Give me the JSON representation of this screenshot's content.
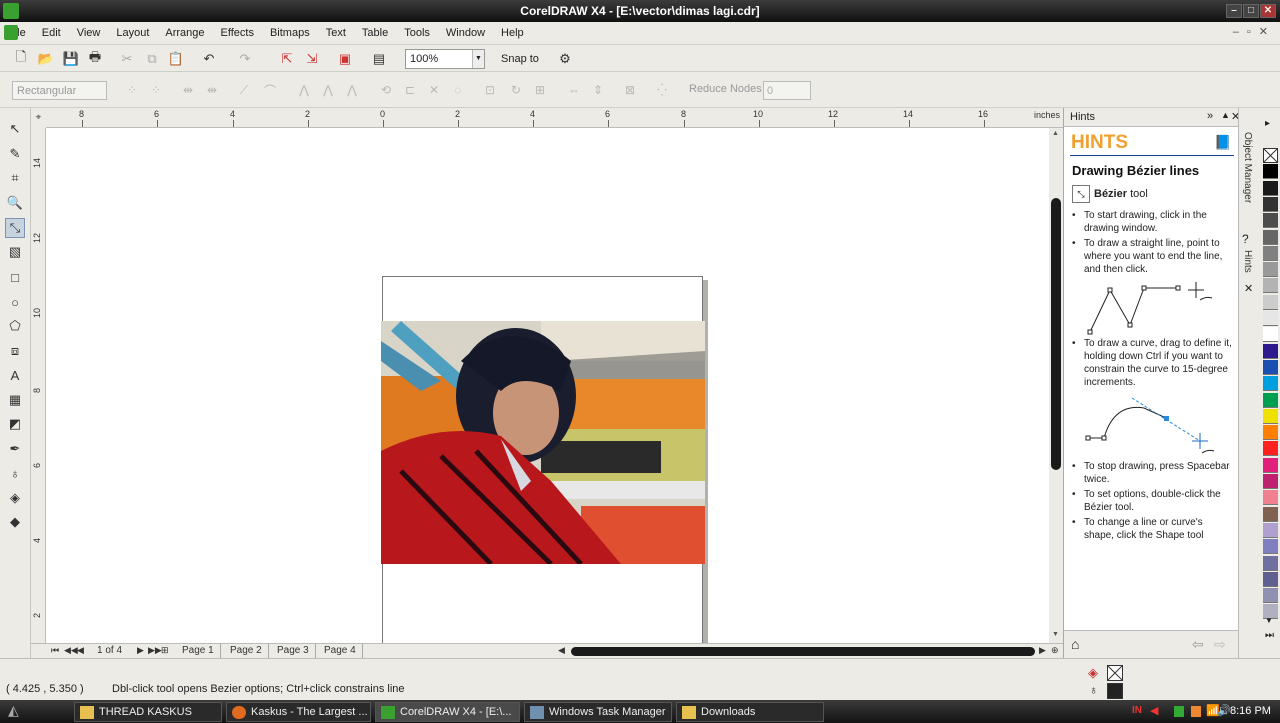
{
  "window": {
    "title": "CorelDRAW X4 - [E:\\vector\\dimas lagi.cdr]",
    "min": "–",
    "max": "□",
    "close": "✕"
  },
  "menu": [
    "File",
    "Edit",
    "View",
    "Layout",
    "Arrange",
    "Effects",
    "Bitmaps",
    "Text",
    "Table",
    "Tools",
    "Window",
    "Help"
  ],
  "toolbar": {
    "zoom": "100%",
    "snap_to": "Snap to"
  },
  "propertybar": {
    "shape_type": "Rectangular",
    "reduce_nodes_label": "Reduce Nodes",
    "reduce_nodes_value": "0"
  },
  "ruler": {
    "units": "inches",
    "h_labels": [
      "8",
      "6",
      "4",
      "2",
      "0",
      "2",
      "4",
      "6",
      "8",
      "10",
      "12",
      "14",
      "16"
    ],
    "v_labels": [
      "14",
      "12",
      "10",
      "8",
      "6",
      "4",
      "2"
    ]
  },
  "pages": {
    "counter": "1 of 4",
    "tabs": [
      "Page 1",
      "Page 2",
      "Page 3",
      "Page 4"
    ]
  },
  "hints": {
    "header": "Hints",
    "big": "HINTS",
    "title": "Drawing Bézier lines",
    "tool_label": "Bézier",
    "tool_suffix": "tool",
    "b1": "To start drawing, click in the drawing window.",
    "b2": "To draw a straight line, point to where you want to end the line, and then click.",
    "b3": "To draw a curve, drag to define it, holding down Ctrl if you want to constrain the curve to 15-degree increments.",
    "b4": "To stop drawing, press Spacebar twice.",
    "b5": "To set options, double-click the Bézier tool.",
    "b6": "To change a line or curve's shape, click the Shape tool"
  },
  "dockers": {
    "object_manager": "Object Manager",
    "hints_tab": "Hints"
  },
  "palette": [
    "#ffffff",
    "#000000",
    "#1a1a1a",
    "#333333",
    "#4d4d4d",
    "#666666",
    "#808080",
    "#999999",
    "#b3b3b3",
    "#cccccc",
    "#e6e6e6",
    "#ffffff",
    "#2e1a8c",
    "#1b4fb0",
    "#00a0e0",
    "#00a050",
    "#f0e000",
    "#ff8000",
    "#ff2020",
    "#e0207a",
    "#c02070",
    "#f08090",
    "#806050",
    "#b0a0d0",
    "#8080c0",
    "#7070a0",
    "#606090",
    "#9090b0",
    "#b0b0c0"
  ],
  "status": {
    "coords": "( 4.425 , 5.350 )",
    "message": "Dbl-click tool opens Bezier options; Ctrl+click constrains line"
  },
  "taskbar": {
    "tasks": [
      "THREAD KASKUS",
      "Kaskus - The Largest ...",
      "CorelDRAW X4 - [E:\\...",
      "Windows Task Manager",
      "Downloads"
    ],
    "clock": "8:16 PM",
    "lang": "IN"
  }
}
